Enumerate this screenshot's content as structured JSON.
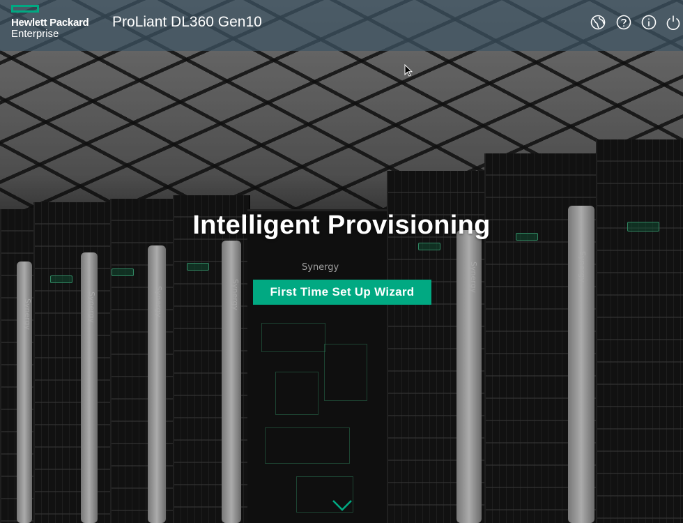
{
  "header": {
    "logo": {
      "line1": "Hewlett Packard",
      "line2": "Enterprise"
    },
    "product_title": "ProLiant DL360 Gen10",
    "icons": [
      "language-globe-icon",
      "help-icon",
      "info-icon",
      "power-icon"
    ]
  },
  "hero": {
    "title": "Intelligent Provisioning",
    "wizard_button": "First Time Set Up Wizard"
  },
  "background": {
    "rack_label": "Synergy"
  },
  "colors": {
    "accent": "#01a982",
    "header_bg": "#3e5564"
  }
}
